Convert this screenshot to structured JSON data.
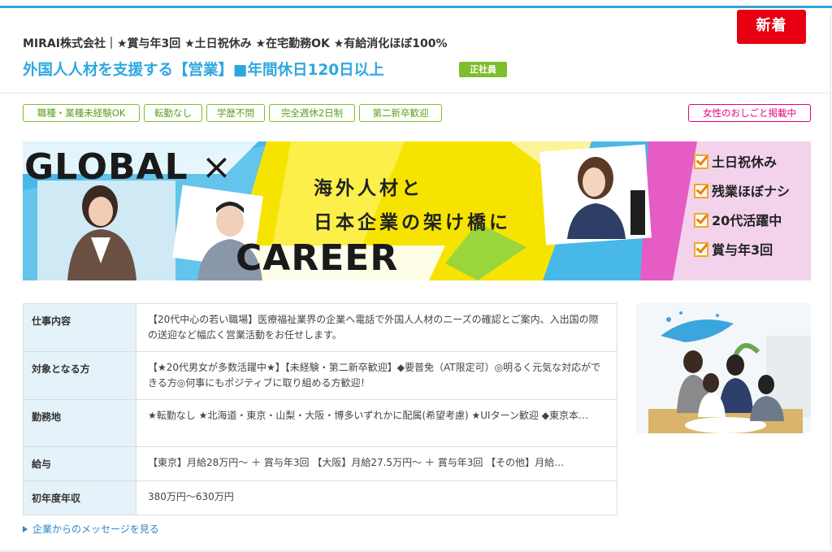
{
  "badge_new": "新着",
  "company_line": "MIRAI株式会社｜★賞与年3回 ★土日祝休み ★在宅勤務OK ★有給消化ほぼ100%",
  "job_title": "外国人人材を支援する【営業】■年間休日120日以上",
  "employment_type": "正社員",
  "tags": [
    "職種・業種未経験OK",
    "転勤なし",
    "学歴不問",
    "完全週休2日制",
    "第二新卒歓迎"
  ],
  "tag_special": "女性のおしごと掲載中",
  "banner": {
    "title_top": "GLOBAL",
    "cross": "×",
    "title_bottom": "CAREER",
    "catch_line1": "海外人材と",
    "catch_line2": "日本企業の架け橋に",
    "points": [
      "土日祝休み",
      "残業ほぼナシ",
      "20代活躍中",
      "賞与年3回"
    ],
    "colors": {
      "sky": "#47b8e8",
      "yellow": "#f6e400",
      "pink": "#e55cc5"
    }
  },
  "details": [
    {
      "label": "仕事内容",
      "value": "【20代中心の若い職場】医療福祉業界の企業へ電話で外国人人材のニーズの確認とご案内、入出国の際の送迎など幅広く営業活動をお任せします。"
    },
    {
      "label": "対象となる方",
      "value": "【★20代男女が多数活躍中★】【未経験・第二新卒歓迎】◆要普免（AT限定可）◎明るく元気な対応ができる方◎何事にもポジティブに取り組める方歓迎！"
    },
    {
      "label": "勤務地",
      "value": "★転勤なし ★北海道・東京・山梨・大阪・博多いずれかに配属(希望考慮) ★UIターン歓迎 ◆東京本…"
    },
    {
      "label": "給与",
      "value": "【東京】月給28万円～ ＋ 賞与年3回 【大阪】月給27.5万円～ ＋ 賞与年3回 【その他】月給…"
    },
    {
      "label": "初年度年収",
      "value": "380万円～630万円"
    }
  ],
  "message_link": "企業からのメッセージを見る",
  "colors": {
    "accent": "#2ea7e0",
    "new": "#e60012",
    "green": "#7dbe2d",
    "pink": "#e4007f"
  }
}
